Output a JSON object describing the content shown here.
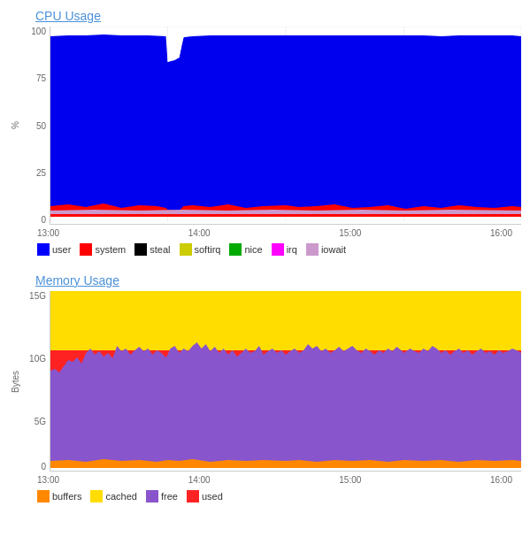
{
  "cpu": {
    "title": "CPU Usage",
    "y_axis": [
      "100",
      "75",
      "50",
      "25",
      "0"
    ],
    "x_axis": [
      "13:00",
      "14:00",
      "15:00",
      "16:00"
    ],
    "legend": [
      {
        "label": "user",
        "color": "#0000ff"
      },
      {
        "label": "system",
        "color": "#ff0000"
      },
      {
        "label": "steal",
        "color": "#000000"
      },
      {
        "label": "softirq",
        "color": "#cccc00"
      },
      {
        "label": "nice",
        "color": "#00aa00"
      },
      {
        "label": "irq",
        "color": "#ff00ff"
      },
      {
        "label": "iowait",
        "color": "#cc99cc"
      }
    ]
  },
  "memory": {
    "title": "Memory Usage",
    "y_axis": [
      "15G",
      "10G",
      "5G",
      "0"
    ],
    "x_axis": [
      "13:00",
      "14:00",
      "15:00",
      "16:00"
    ],
    "y_label": "Bytes",
    "legend": [
      {
        "label": "buffers",
        "color": "#ff8800"
      },
      {
        "label": "cached",
        "color": "#ffdd00"
      },
      {
        "label": "free",
        "color": "#8855cc"
      },
      {
        "label": "used",
        "color": "#ff2222"
      }
    ]
  }
}
